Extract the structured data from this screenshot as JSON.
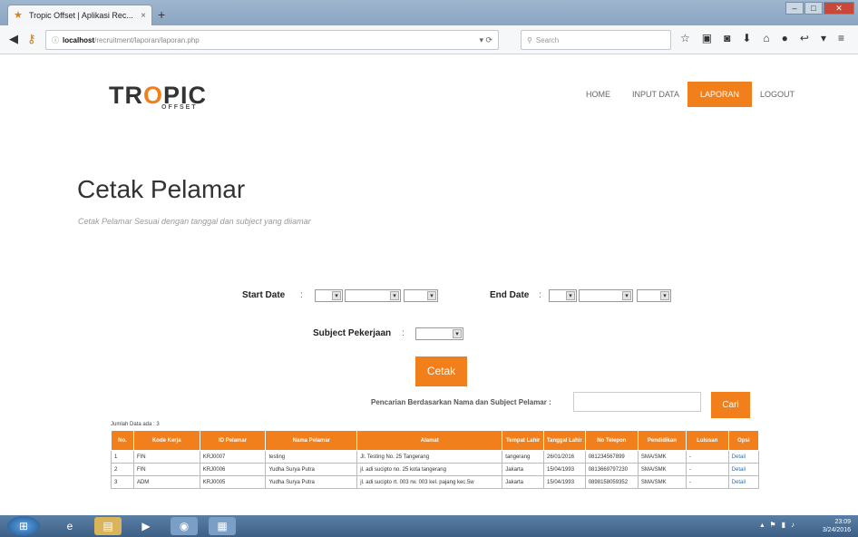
{
  "browser": {
    "tab_title": "Tropic Offset | Aplikasi Rec...",
    "tab_close": "×",
    "new_tab": "+",
    "url_host": "localhost",
    "url_path": "/recruitment/laporan/laporan.php",
    "search_placeholder": "Search"
  },
  "header": {
    "logo_text_1": "TR",
    "logo_text_o": "O",
    "logo_text_2": "PIC",
    "logo_sub": "OFFSET",
    "menu": [
      "HOME",
      "INPUT DATA",
      "LAPORAN",
      "LOGOUT"
    ]
  },
  "page": {
    "title": "Cetak Pelamar",
    "subtitle": "Cetak Pelamar Sesuai dengan tanggal dan subject yang diiamar"
  },
  "form": {
    "start_date_label": "Start Date",
    "end_date_label": "End Date",
    "subject_label": "Subject Pekerjaan",
    "colon": ":",
    "print_button": "Cetak",
    "search_label": "Pencarian Berdasarkan Nama dan Subject Pelamar :",
    "search_button": "Cari"
  },
  "table": {
    "count_text": "Jumlah Data ada : 3",
    "headers": [
      "No.",
      "Kode Kerja",
      "ID Pelamar",
      "Nama Pelamar",
      "Alamat",
      "Tempat Lahir",
      "Tanggal Lahir",
      "No Telepon",
      "Pendidikan",
      "Lulusan",
      "Opsi"
    ],
    "rows": [
      [
        "1",
        "FIN",
        "KRJ0007",
        "testing",
        "Jl. Testing No. 25 Tangerang",
        "tangerang",
        "26/01/2016",
        "081234567899",
        "SMA/SMK",
        "-",
        "Detail"
      ],
      [
        "2",
        "FIN",
        "KRJ0006",
        "Yudha Surya Putra",
        "jl. adi sucipto no. 25 kota tangerang",
        "Jakarta",
        "15/04/1993",
        "0813669797230",
        "SMA/SMK",
        "-",
        "Detail"
      ],
      [
        "3",
        "ADM",
        "KRJ0005",
        "Yudha Surya Putra",
        "jl. adi sucipto rt. 003 rw. 003 kel. pajang kec.5w",
        "Jakarta",
        "15/04/1993",
        "0898158059352",
        "SMA/SMK",
        "-",
        "Detail"
      ]
    ]
  },
  "taskbar": {
    "time": "23:09",
    "date": "3/24/2016"
  }
}
